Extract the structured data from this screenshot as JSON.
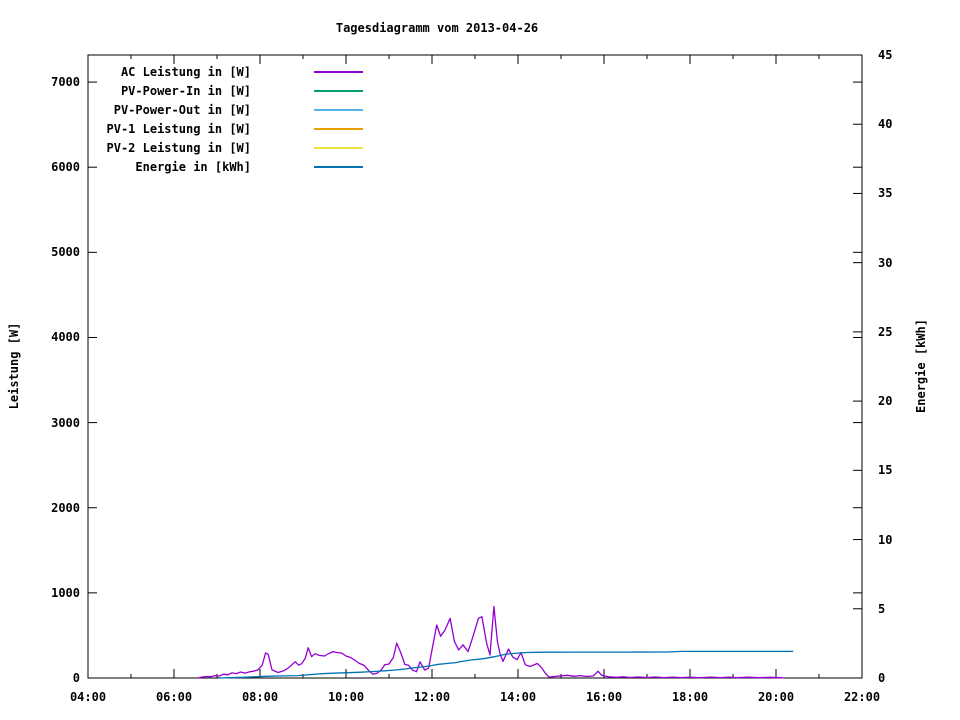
{
  "title": "Tagesdiagramm vom 2013-04-26",
  "chart_data": {
    "type": "line",
    "title": "Tagesdiagramm vom 2013-04-26",
    "background": "#ffffff",
    "axis_color": "#000000",
    "legend_position": "top-left-inside",
    "grid": false,
    "x_axis": {
      "range_hours": [
        4,
        22
      ],
      "major_tick_hours": [
        4,
        6,
        8,
        10,
        12,
        14,
        16,
        18,
        20,
        22
      ],
      "major_tick_labels": [
        "04:00",
        "06:00",
        "08:00",
        "10:00",
        "12:00",
        "14:00",
        "16:00",
        "18:00",
        "20:00",
        "22:00"
      ],
      "minor_tick_every_hours": 1
    },
    "y_left": {
      "label": "Leistung [W]",
      "ticks": [
        0,
        1000,
        2000,
        3000,
        4000,
        5000,
        6000,
        7000
      ],
      "tick_labels": [
        "0",
        "1000",
        "2000",
        "3000",
        "4000",
        "5000",
        "6000",
        "7000"
      ],
      "range": [
        0,
        7318
      ]
    },
    "y_right": {
      "label": "Energie [kWh]",
      "ticks": [
        0,
        5,
        10,
        15,
        20,
        25,
        30,
        35,
        40,
        45
      ],
      "tick_labels": [
        "0",
        "5",
        "10",
        "15",
        "20",
        "25",
        "30",
        "35",
        "40",
        "45"
      ],
      "range": [
        0,
        45
      ]
    },
    "series": [
      {
        "name": "AC Leistung in [W]",
        "color": "#9400d3",
        "axis": "left",
        "visible_curve": true,
        "points": [
          [
            6.55,
            0
          ],
          [
            6.65,
            10
          ],
          [
            6.75,
            18
          ],
          [
            6.85,
            15
          ],
          [
            6.95,
            28
          ],
          [
            7.05,
            22
          ],
          [
            7.15,
            45
          ],
          [
            7.25,
            38
          ],
          [
            7.35,
            60
          ],
          [
            7.45,
            52
          ],
          [
            7.55,
            70
          ],
          [
            7.65,
            58
          ],
          [
            7.75,
            72
          ],
          [
            7.85,
            80
          ],
          [
            7.95,
            95
          ],
          [
            8.05,
            150
          ],
          [
            8.13,
            295
          ],
          [
            8.19,
            278
          ],
          [
            8.28,
            95
          ],
          [
            8.42,
            65
          ],
          [
            8.55,
            85
          ],
          [
            8.65,
            115
          ],
          [
            8.75,
            160
          ],
          [
            8.82,
            192
          ],
          [
            8.9,
            150
          ],
          [
            8.97,
            168
          ],
          [
            9.05,
            230
          ],
          [
            9.12,
            356
          ],
          [
            9.2,
            250
          ],
          [
            9.28,
            285
          ],
          [
            9.38,
            265
          ],
          [
            9.5,
            258
          ],
          [
            9.6,
            288
          ],
          [
            9.7,
            310
          ],
          [
            9.8,
            298
          ],
          [
            9.9,
            292
          ],
          [
            10.0,
            258
          ],
          [
            10.1,
            242
          ],
          [
            10.2,
            212
          ],
          [
            10.3,
            175
          ],
          [
            10.42,
            148
          ],
          [
            10.52,
            92
          ],
          [
            10.62,
            45
          ],
          [
            10.72,
            55
          ],
          [
            10.82,
            95
          ],
          [
            10.9,
            155
          ],
          [
            11.0,
            165
          ],
          [
            11.1,
            240
          ],
          [
            11.18,
            410
          ],
          [
            11.28,
            290
          ],
          [
            11.37,
            158
          ],
          [
            11.45,
            152
          ],
          [
            11.55,
            92
          ],
          [
            11.64,
            74
          ],
          [
            11.72,
            190
          ],
          [
            11.83,
            94
          ],
          [
            11.92,
            115
          ],
          [
            12.0,
            330
          ],
          [
            12.11,
            622
          ],
          [
            12.2,
            490
          ],
          [
            12.3,
            560
          ],
          [
            12.42,
            700
          ],
          [
            12.52,
            430
          ],
          [
            12.62,
            330
          ],
          [
            12.72,
            390
          ],
          [
            12.84,
            310
          ],
          [
            12.95,
            480
          ],
          [
            13.08,
            700
          ],
          [
            13.16,
            720
          ],
          [
            13.27,
            410
          ],
          [
            13.35,
            270
          ],
          [
            13.44,
            840
          ],
          [
            13.52,
            430
          ],
          [
            13.58,
            290
          ],
          [
            13.65,
            195
          ],
          [
            13.78,
            340
          ],
          [
            13.88,
            245
          ],
          [
            13.98,
            215
          ],
          [
            14.07,
            300
          ],
          [
            14.17,
            155
          ],
          [
            14.28,
            135
          ],
          [
            14.45,
            170
          ],
          [
            14.55,
            120
          ],
          [
            14.63,
            60
          ],
          [
            14.72,
            10
          ],
          [
            14.85,
            18
          ],
          [
            15.0,
            26
          ],
          [
            15.15,
            32
          ],
          [
            15.3,
            20
          ],
          [
            15.45,
            28
          ],
          [
            15.6,
            18
          ],
          [
            15.75,
            25
          ],
          [
            15.86,
            80
          ],
          [
            15.95,
            30
          ],
          [
            16.1,
            14
          ],
          [
            16.3,
            8
          ],
          [
            16.45,
            14
          ],
          [
            16.6,
            6
          ],
          [
            16.8,
            12
          ],
          [
            17.0,
            6
          ],
          [
            17.2,
            12
          ],
          [
            17.4,
            5
          ],
          [
            17.6,
            10
          ],
          [
            17.8,
            4
          ],
          [
            18.0,
            10
          ],
          [
            18.2,
            4
          ],
          [
            18.5,
            10
          ],
          [
            18.7,
            4
          ],
          [
            18.9,
            10
          ],
          [
            19.1,
            4
          ],
          [
            19.35,
            9
          ],
          [
            19.6,
            4
          ],
          [
            19.85,
            8
          ],
          [
            20.1,
            3
          ],
          [
            20.2,
            0
          ]
        ]
      },
      {
        "name": "PV-Power-In in [W]",
        "color": "#009e73",
        "axis": "left",
        "visible_curve": false,
        "points": []
      },
      {
        "name": "PV-Power-Out in [W]",
        "color": "#56b4e9",
        "axis": "left",
        "visible_curve": false,
        "points": []
      },
      {
        "name": "PV-1 Leistung in [W]",
        "color": "#e69f00",
        "axis": "left",
        "visible_curve": false,
        "points": []
      },
      {
        "name": "PV-2 Leistung in [W]",
        "color": "#f0e442",
        "axis": "left",
        "visible_curve": false,
        "points": []
      },
      {
        "name": "Energie in [kWh]",
        "color": "#0072b2",
        "axis": "right",
        "visible_curve": true,
        "points": [
          [
            7.05,
            0.0
          ],
          [
            7.3,
            0.02
          ],
          [
            7.6,
            0.05
          ],
          [
            7.9,
            0.09
          ],
          [
            8.2,
            0.13
          ],
          [
            8.55,
            0.15
          ],
          [
            8.88,
            0.17
          ],
          [
            9.2,
            0.25
          ],
          [
            9.45,
            0.31
          ],
          [
            9.7,
            0.35
          ],
          [
            10.05,
            0.38
          ],
          [
            10.35,
            0.42
          ],
          [
            10.6,
            0.46
          ],
          [
            10.9,
            0.52
          ],
          [
            11.15,
            0.58
          ],
          [
            11.37,
            0.65
          ],
          [
            11.6,
            0.75
          ],
          [
            11.83,
            0.82
          ],
          [
            12.0,
            0.9
          ],
          [
            12.15,
            0.99
          ],
          [
            12.35,
            1.05
          ],
          [
            12.55,
            1.11
          ],
          [
            12.7,
            1.2
          ],
          [
            12.9,
            1.3
          ],
          [
            13.1,
            1.36
          ],
          [
            13.25,
            1.42
          ],
          [
            13.45,
            1.54
          ],
          [
            13.6,
            1.63
          ],
          [
            13.7,
            1.71
          ],
          [
            13.85,
            1.76
          ],
          [
            14.0,
            1.8
          ],
          [
            14.2,
            1.84
          ],
          [
            14.6,
            1.86
          ],
          [
            15.5,
            1.87
          ],
          [
            16.5,
            1.87
          ],
          [
            17.5,
            1.88
          ],
          [
            17.8,
            1.92
          ],
          [
            18.5,
            1.92
          ],
          [
            19.5,
            1.92
          ],
          [
            20.4,
            1.92
          ]
        ]
      }
    ]
  }
}
